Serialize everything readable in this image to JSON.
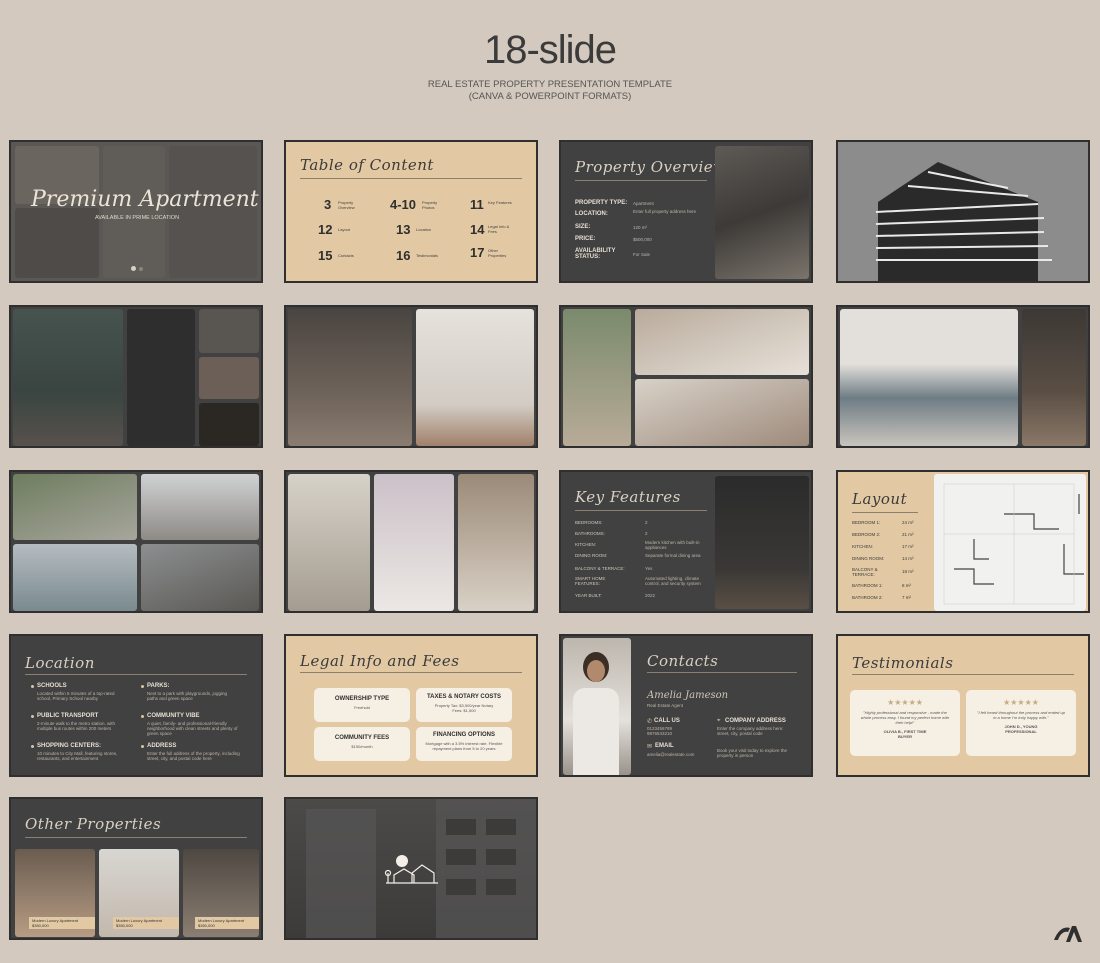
{
  "header": {
    "title": "18-slide",
    "subtitle_line1": "REAL ESTATE PROPERTY PRESENTATION TEMPLATE",
    "subtitle_line2": "(CANVA & POWERPOINT FORMATS)"
  },
  "slides": {
    "s1": {
      "title": "Premium Apartment",
      "tagline": "AVAILABLE IN PRIME LOCATION"
    },
    "s2": {
      "title": "Table of Content",
      "items": [
        {
          "num": "3",
          "label": "Property Overview"
        },
        {
          "num": "4-10",
          "label": "Property Photos"
        },
        {
          "num": "11",
          "label": "Key Features"
        },
        {
          "num": "12",
          "label": "Layout"
        },
        {
          "num": "13",
          "label": "Location"
        },
        {
          "num": "14",
          "label": "Legal Info & Fees"
        },
        {
          "num": "15",
          "label": "Contacts"
        },
        {
          "num": "16",
          "label": "Testimonials"
        },
        {
          "num": "17",
          "label": "Other Properties"
        }
      ]
    },
    "s3": {
      "title": "Property Overview",
      "rows": [
        {
          "label": "PROPERTY TYPE:",
          "value": "Apartment"
        },
        {
          "label": "LOCATION:",
          "value": "Enter full property address here"
        },
        {
          "label": "SIZE:",
          "value": "120 m²"
        },
        {
          "label": "PRICE:",
          "value": "$500,000"
        },
        {
          "label": "AVAILABILITY STATUS:",
          "value": "For Sale"
        }
      ]
    },
    "s11": {
      "title": "Key Features",
      "rows": [
        {
          "label": "BEDROOMS:",
          "value": "2"
        },
        {
          "label": "BATHROOMS:",
          "value": "2"
        },
        {
          "label": "KITCHEN:",
          "value": "Modern kitchen with built-in appliances"
        },
        {
          "label": "DINING ROOM:",
          "value": "Separate formal dining area"
        },
        {
          "label": "BALCONY & TERRACE:",
          "value": "Yes"
        },
        {
          "label": "SMART HOME FEATURES:",
          "value": "Automated lighting, climate control, and security system"
        },
        {
          "label": "YEAR BUILT:",
          "value": "2022"
        }
      ]
    },
    "s12": {
      "title": "Layout",
      "rows": [
        {
          "label": "BEDROOM 1:",
          "value": "24 m²"
        },
        {
          "label": "BEDROOM 2:",
          "value": "21 m²"
        },
        {
          "label": "KITCHEN:",
          "value": "17 m²"
        },
        {
          "label": "DINING ROOM:",
          "value": "14 m²"
        },
        {
          "label": "BALCONY & TERRACE:",
          "value": "18 m²"
        },
        {
          "label": "BATHROOM 1:",
          "value": "8 m²"
        },
        {
          "label": "BATHROOM 2:",
          "value": "7 m²"
        }
      ]
    },
    "s13": {
      "title": "Location",
      "items": [
        {
          "label": "SCHOOLS",
          "text": "Located within 5 minutes of a top-rated school, Primary School nearby"
        },
        {
          "label": "PARKS:",
          "text": "Next to a park with playgrounds, jogging paths and green space"
        },
        {
          "label": "PUBLIC TRANSPORT",
          "text": "2-minute walk to the metro station, with multiple bus routes within 200 meters"
        },
        {
          "label": "COMMUNITY VIBE",
          "text": "A quiet, family- and professional-friendly neighborhood with clean streets and plenty of green space"
        },
        {
          "label": "SHOPPING CENTERS:",
          "text": "10 minutes to City Mall, featuring stores, restaurants, and entertainment"
        },
        {
          "label": "ADDRESS",
          "text": "Enter the full address of the property, including street, city, and postal code here"
        }
      ]
    },
    "s14": {
      "title": "Legal Info and Fees",
      "cards": [
        {
          "title": "OWNERSHIP TYPE",
          "sub": "Freehold"
        },
        {
          "title": "TAXES & NOTARY COSTS",
          "sub": "Property Tax: $3,500/year Notary Fees: $1,500"
        },
        {
          "title": "COMMUNITY FEES",
          "sub": "$150/month"
        },
        {
          "title": "FINANCING OPTIONS",
          "sub": "Mortgage with a 3.5% interest rate. Flexible repayment plans from 5 to 20 years"
        }
      ]
    },
    "s15": {
      "title": "Contacts",
      "name": "Amelia Jameson",
      "role": "Real Estate Agent",
      "call_label": "CALL US",
      "call_value": "0123456789 9876543210",
      "address_label": "COMPANY ADDRESS",
      "address_value": "Enter the company address here: street, city, postal code",
      "email_label": "EMAIL",
      "email_value": "amelia@realestate.com",
      "visit_text": "Book your visit today to explore the property in person"
    },
    "s16": {
      "title": "Testimonials",
      "stars": "★★★★★",
      "t1_text": "\"Highly professional and responsive - made the whole process easy. I found my perfect home with their help!\"",
      "t1_author": "OLIVIA B., FIRST TIME BUYER",
      "t2_text": "\"I felt heard throughout the process and ended up in a home I'm truly happy with.\"",
      "t2_author": "JOHN D., YOUNG PROFESSIONAL"
    },
    "s17": {
      "title": "Other Properties",
      "caption": "Modern Luxury Apartment $350,000"
    }
  },
  "brand": {
    "accent": "#e3c9a3",
    "dark": "#414141",
    "background": "#d4c9be"
  },
  "watermark_icon": "logo-mark"
}
